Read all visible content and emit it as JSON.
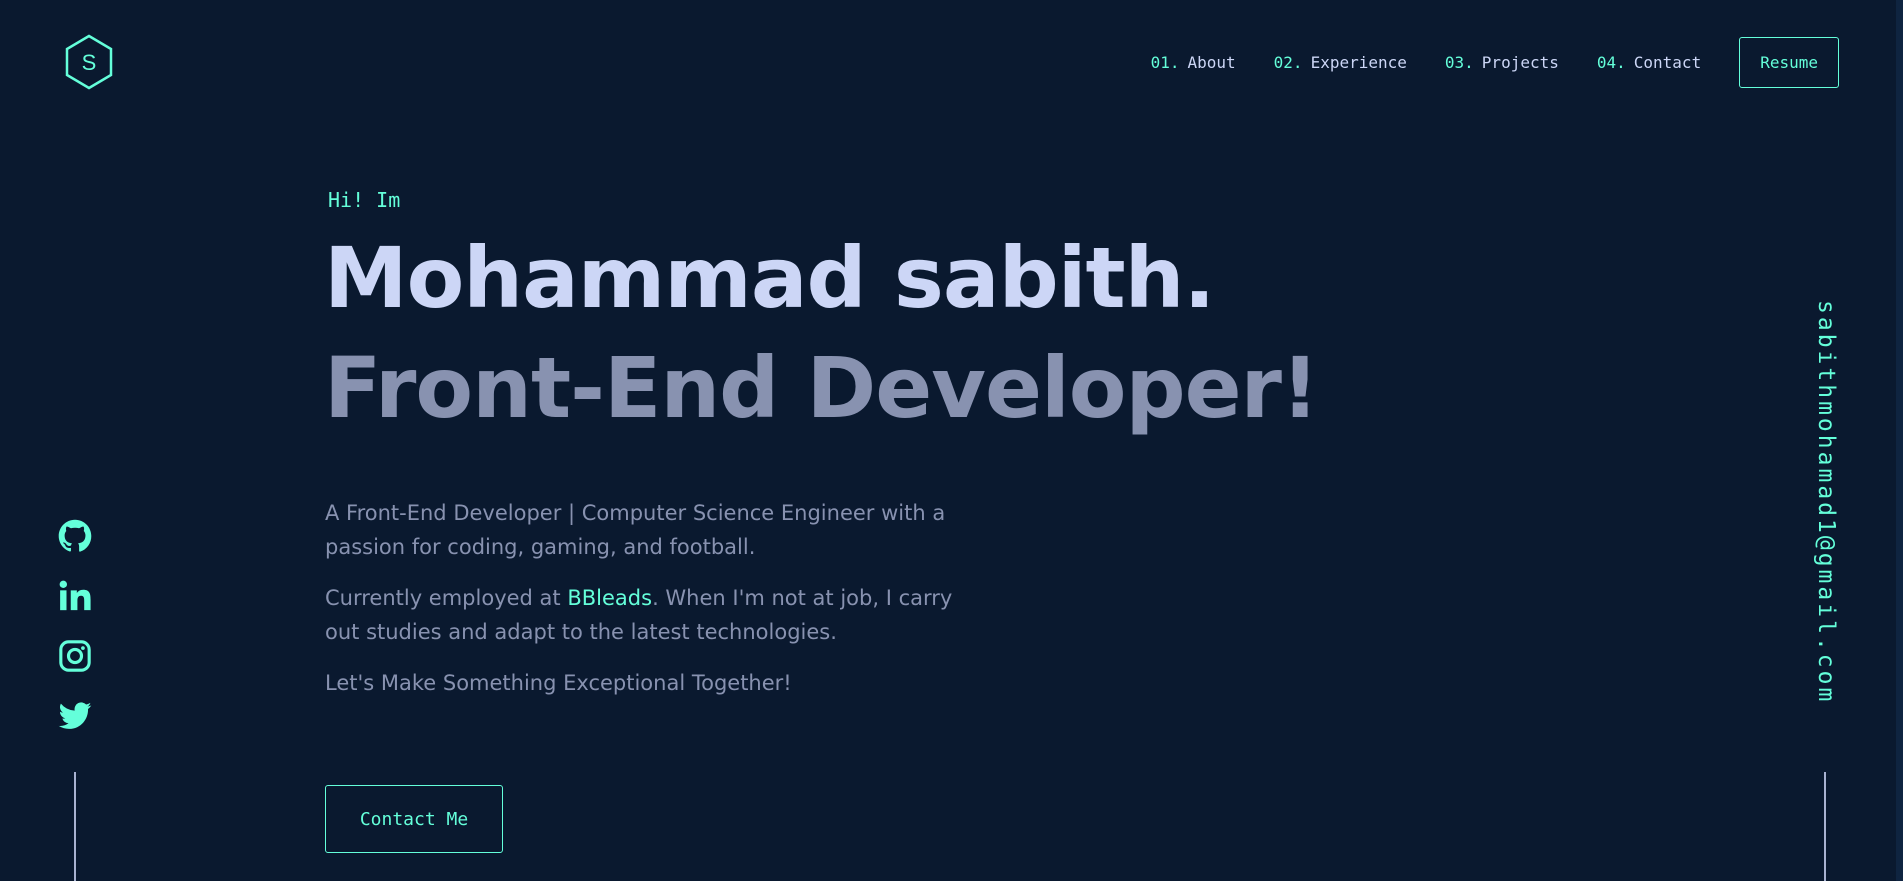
{
  "logo": {
    "letter": "S",
    "icon": "hexagon-logo-icon"
  },
  "nav": {
    "items": [
      {
        "num": "01.",
        "label": "About"
      },
      {
        "num": "02.",
        "label": "Experience"
      },
      {
        "num": "03.",
        "label": "Projects"
      },
      {
        "num": "04.",
        "label": "Contact"
      }
    ],
    "resume_label": "Resume"
  },
  "hero": {
    "intro": "Hi! Im",
    "name": "Mohammad sabith.",
    "role": "Front-End Developer!",
    "bio_1": "A Front-End Developer | Computer Science Engineer with a passion for coding, gaming, and football.",
    "bio_2_prefix": "Currently employed at ",
    "bio_2_company": "BBleads",
    "bio_2_suffix": ". When I'm not at job, I carry out studies and adapt to the latest technologies.",
    "bio_3": "Let's Make Something Exceptional Together!",
    "contact_label": "Contact Me"
  },
  "social": {
    "icons": [
      "github-icon",
      "linkedin-icon",
      "instagram-icon",
      "twitter-icon"
    ]
  },
  "email": "sabithmohamad1@gmail.com",
  "colors": {
    "background": "#0a192f",
    "accent": "#64ffda",
    "heading": "#ccd6f6",
    "text": "#8892b0"
  }
}
